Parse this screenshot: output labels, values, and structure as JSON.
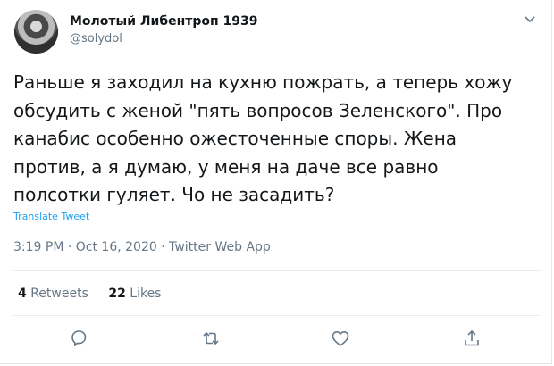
{
  "author": {
    "display_name": "Молотый Либентроп 1939",
    "handle": "@solydol",
    "avatar_icon": "avatar-photo"
  },
  "tweet": {
    "text": "Раньше я заходил на кухню пожрать, а теперь хожу\nобсудить с женой \"пять вопросов Зеленского\". Про\nканабис особенно ожесточенные споры. Жена\nпротив, а я думаю, у меня на даче все равно\nполсотки гуляет. Чо не засадить?",
    "translate_label": "Translate Tweet",
    "timestamp": "3:19 PM · Oct 16, 2020 · Twitter Web App"
  },
  "stats": {
    "retweets_count": "4",
    "retweets_label": "Retweets",
    "likes_count": "22",
    "likes_label": "Likes"
  },
  "actions": {
    "icons": [
      "reply-icon",
      "retweet-icon",
      "like-icon",
      "share-icon"
    ]
  },
  "colors": {
    "text": "#14171a",
    "secondary": "#657786",
    "link": "#1da1f2",
    "divider": "#e6ecf0"
  }
}
